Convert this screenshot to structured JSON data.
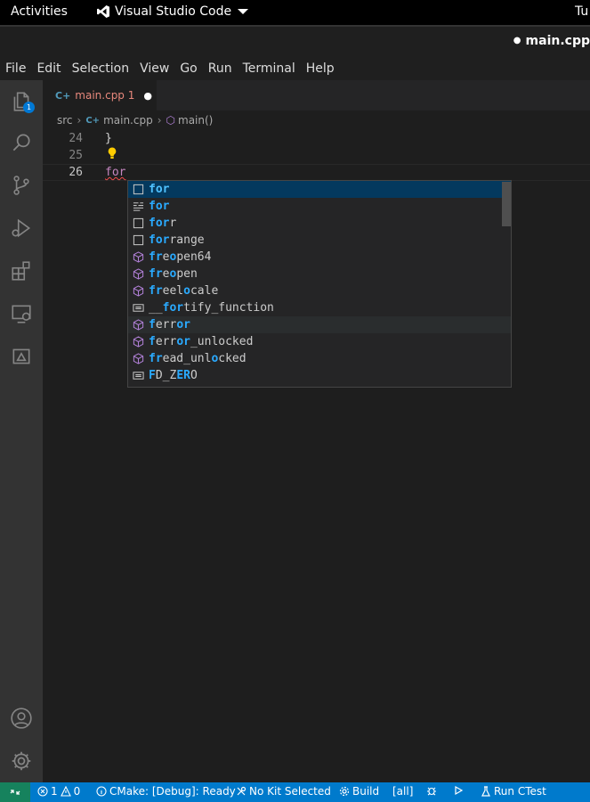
{
  "topbar": {
    "activities": "Activities",
    "app_name": "Visual Studio Code",
    "clock": "Tu"
  },
  "titlebar": {
    "title": "main.cpp"
  },
  "menu": [
    "File",
    "Edit",
    "Selection",
    "View",
    "Go",
    "Run",
    "Terminal",
    "Help"
  ],
  "activitybar": {
    "explorer_badge": "1"
  },
  "tab": {
    "icon_label": "C+",
    "filename": "main.cpp",
    "problem_count": "1",
    "modified_dot": "●"
  },
  "breadcrumb": {
    "folder": "src",
    "file": "main.cpp",
    "symbol": "main()"
  },
  "editor": {
    "lines": [
      {
        "number": "24",
        "text": "}"
      },
      {
        "number": "25",
        "text": ""
      },
      {
        "number": "26",
        "text": "for"
      }
    ]
  },
  "suggestions": [
    {
      "icon": "snippet-icon",
      "parts": [
        [
          "for",
          true
        ]
      ]
    },
    {
      "icon": "keyword-icon",
      "parts": [
        [
          "for",
          true
        ]
      ]
    },
    {
      "icon": "snippet-icon",
      "parts": [
        [
          "for",
          true
        ],
        [
          "r",
          false
        ]
      ]
    },
    {
      "icon": "snippet-icon",
      "parts": [
        [
          "for",
          true
        ],
        [
          "range",
          false
        ]
      ]
    },
    {
      "icon": "method-icon",
      "parts": [
        [
          "fr",
          true
        ],
        [
          "e",
          false
        ],
        [
          "o",
          true
        ],
        [
          "pen64",
          false
        ]
      ]
    },
    {
      "icon": "method-icon",
      "parts": [
        [
          "fr",
          true
        ],
        [
          "e",
          false
        ],
        [
          "o",
          true
        ],
        [
          "pen",
          false
        ]
      ]
    },
    {
      "icon": "method-icon",
      "parts": [
        [
          "fr",
          true
        ],
        [
          "eel",
          false
        ],
        [
          "o",
          true
        ],
        [
          "cale",
          false
        ]
      ]
    },
    {
      "icon": "variable-icon",
      "parts": [
        [
          "__",
          false
        ],
        [
          "for",
          true
        ],
        [
          "tify_function",
          false
        ]
      ]
    },
    {
      "icon": "method-icon",
      "parts": [
        [
          "f",
          true
        ],
        [
          "err",
          false
        ],
        [
          "or",
          true
        ]
      ]
    },
    {
      "icon": "method-icon",
      "parts": [
        [
          "f",
          true
        ],
        [
          "err",
          false
        ],
        [
          "or",
          true
        ],
        [
          "_unlocked",
          false
        ]
      ]
    },
    {
      "icon": "method-icon",
      "parts": [
        [
          "fr",
          true
        ],
        [
          "ead_unl",
          false
        ],
        [
          "o",
          true
        ],
        [
          "cked",
          false
        ]
      ]
    },
    {
      "icon": "variable-icon",
      "parts": [
        [
          "F",
          true
        ],
        [
          "D_Z",
          false
        ],
        [
          "ER",
          true
        ],
        [
          "O",
          false
        ]
      ]
    }
  ],
  "statusbar": {
    "errors": "1",
    "warnings": "0",
    "cmake": "CMake: [Debug]: Ready",
    "kit": "No Kit Selected",
    "build": "Build",
    "target": "[all]",
    "ctest": "Run CTest"
  }
}
